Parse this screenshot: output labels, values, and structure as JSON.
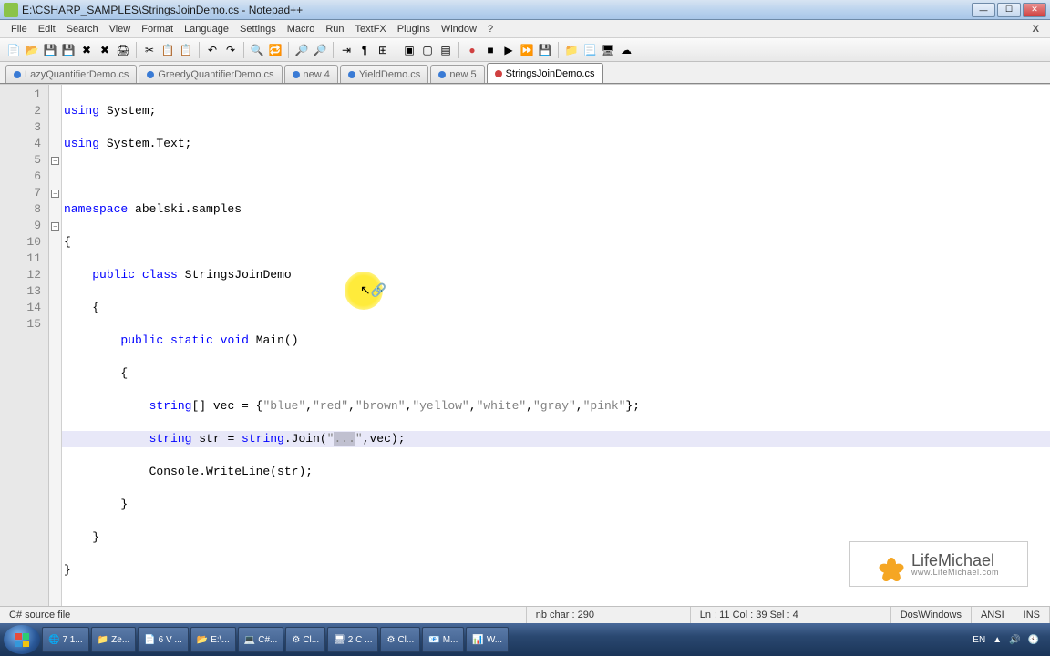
{
  "title": "E:\\CSHARP_SAMPLES\\StringsJoinDemo.cs - Notepad++",
  "menu": [
    "File",
    "Edit",
    "Search",
    "View",
    "Format",
    "Language",
    "Settings",
    "Macro",
    "Run",
    "TextFX",
    "Plugins",
    "Window",
    "?"
  ],
  "tabs": [
    {
      "label": "LazyQuantifierDemo.cs",
      "dirty": false
    },
    {
      "label": "GreedyQuantifierDemo.cs",
      "dirty": false
    },
    {
      "label": "new  4",
      "dirty": false
    },
    {
      "label": "YieldDemo.cs",
      "dirty": false
    },
    {
      "label": "new  5",
      "dirty": false
    },
    {
      "label": "StringsJoinDemo.cs",
      "dirty": true,
      "active": true
    }
  ],
  "line_numbers": [
    "1",
    "2",
    "3",
    "4",
    "5",
    "6",
    "7",
    "8",
    "9",
    "10",
    "11",
    "12",
    "13",
    "14",
    "15"
  ],
  "code": {
    "l1": {
      "kw": "using",
      "rest": " System;"
    },
    "l2": {
      "kw": "using",
      "rest": " System.Text;"
    },
    "l4a": "namespace",
    "l4b": " abelski.samples",
    "l5": "{",
    "l6a": "    ",
    "l6b": "public",
    "l6c": " ",
    "l6d": "class",
    "l6e": " StringsJoinDemo",
    "l7": "    {",
    "l8a": "        ",
    "l8b": "public",
    "l8c": " ",
    "l8d": "static",
    "l8e": " ",
    "l8f": "void",
    "l8g": " Main()",
    "l9": "        {",
    "l10a": "            ",
    "l10b": "string",
    "l10c": "[] vec = {",
    "l10d": "\"blue\"",
    "l10e": ",",
    "l10f": "\"red\"",
    "l10g": ",",
    "l10h": "\"brown\"",
    "l10i": ",",
    "l10j": "\"yellow\"",
    "l10k": ",",
    "l10l": "\"white\"",
    "l10m": ",",
    "l10n": "\"gray\"",
    "l10o": ",",
    "l10p": "\"pink\"",
    "l10q": "};",
    "l11a": "            ",
    "l11b": "string",
    "l11c": " str = ",
    "l11d": "string",
    "l11e": ".Join(",
    "l11f": "\"",
    "l11sel": "...",
    "l11g": "\"",
    "l11h": ",vec);",
    "l12": "            Console.WriteLine(str);",
    "l13": "        }",
    "l14": "    }",
    "l15": "}"
  },
  "status": {
    "filetype": "C# source file",
    "chars": "nb char : 290",
    "pos": "Ln : 11    Col : 39    Sel : 4",
    "eol": "Dos\\Windows",
    "enc": "ANSI",
    "mode": "INS"
  },
  "taskbar": {
    "items": [
      "7 1...",
      "Ze...",
      "6 V ...",
      "E:\\...",
      "C#...",
      "Cl...",
      "2 C ...",
      "Cl...",
      "M...",
      "W..."
    ],
    "lang": "EN",
    "tray_icons": [
      "▲",
      "🔊",
      "🕙"
    ]
  },
  "watermark": {
    "name": "LifeMichael",
    "url": "www.LifeMichael.com"
  }
}
